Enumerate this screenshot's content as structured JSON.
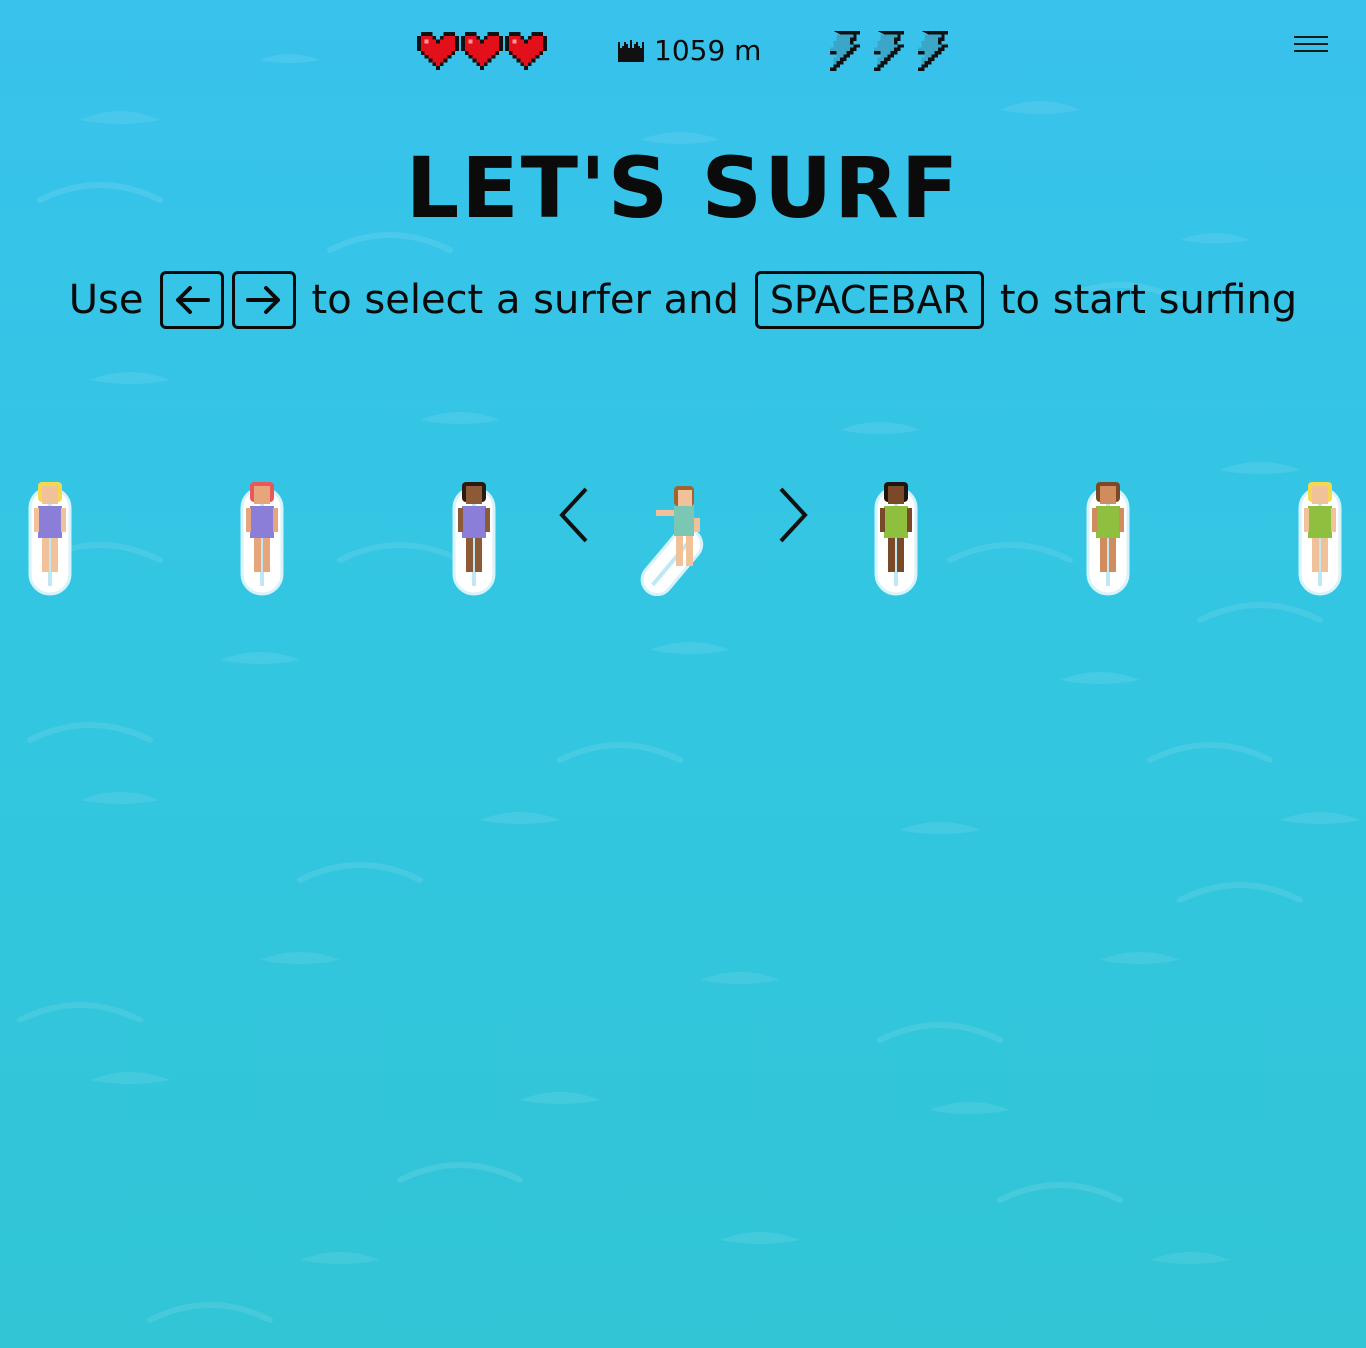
{
  "hud": {
    "lives": 3,
    "lives_icon": "heart-icon",
    "best_icon": "crown-icon",
    "best_distance": "1059 m",
    "boosts": 3,
    "boost_icon": "lightning-bolt-icon",
    "menu_icon": "hamburger-menu-icon"
  },
  "title": "LET'S SURF",
  "instructions": {
    "part1": "Use",
    "key_left": "left-arrow-key",
    "key_right": "right-arrow-key",
    "part2": "to select a surfer and",
    "key_space": "SPACEBAR",
    "part3": "to start surfing"
  },
  "surfers": [
    {
      "hair": "#f4d94e",
      "skin": "#f1c19a",
      "outfit": "#8a7ed8",
      "selected": false
    },
    {
      "hair": "#e8575a",
      "skin": "#e7a57c",
      "outfit": "#8a7ed8",
      "selected": false
    },
    {
      "hair": "#2a1a12",
      "skin": "#8c5a36",
      "outfit": "#8a7ed8",
      "selected": false
    },
    {
      "hair": "#a0642e",
      "skin": "#f1c19a",
      "outfit": "#7cc6b4",
      "selected": true
    },
    {
      "hair": "#1e1410",
      "skin": "#7a4a28",
      "outfit": "#8fbf3e",
      "selected": false
    },
    {
      "hair": "#7a4a28",
      "skin": "#d08c5c",
      "outfit": "#8fbf3e",
      "selected": false
    },
    {
      "hair": "#f4d94e",
      "skin": "#f1c19a",
      "outfit": "#8fbf3e",
      "selected": false
    }
  ],
  "nav": {
    "prev_icon": "chevron-left-icon",
    "next_icon": "chevron-right-icon"
  },
  "colors": {
    "ocean_top": "#38c2ec",
    "ocean_bottom": "#31c5d6",
    "heart": "#e3101c"
  }
}
